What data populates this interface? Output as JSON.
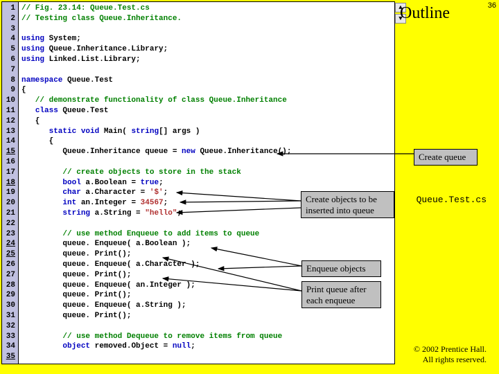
{
  "slide_number": "36",
  "outline": "Outline",
  "filename": "Queue.Test.cs",
  "copyright_line1": "© 2002 Prentice Hall.",
  "copyright_line2": "All rights reserved.",
  "scroll": {
    "up": "▲",
    "down": "▼"
  },
  "callouts": {
    "create_queue": "Create queue",
    "create_objects": "Create objects to be inserted into queue",
    "enqueue_objects": "Enqueue objects",
    "print_after": "Print queue after each enqueue"
  },
  "line_numbers": [
    "1",
    "2",
    "3",
    "4",
    "5",
    "6",
    "7",
    "8",
    "9",
    "10",
    "11",
    "12",
    "13",
    "14",
    "15",
    "16",
    "17",
    "18",
    "19",
    "20",
    "21",
    "22",
    "23",
    "24",
    "25",
    "26",
    "27",
    "28",
    "29",
    "30",
    "31",
    "32",
    "33",
    "34",
    "35"
  ],
  "underlined_lines": [
    "15",
    "18",
    "24",
    "25",
    "35"
  ],
  "code": {
    "l1": "// Fig. 23.14: Queue.Test.cs",
    "l2": "// Testing class Queue.Inheritance.",
    "l4a": "using",
    "l4b": " System;",
    "l5a": "using",
    "l5b": " Queue.Inheritance.Library;",
    "l6a": "using",
    "l6b": " Linked.List.Library;",
    "l8a": "namespace",
    "l8b": " Queue.Test",
    "l9": "{",
    "l10": "   // demonstrate functionality of class Queue.Inheritance",
    "l11a": "   ",
    "l11b": "class",
    "l11c": " Queue.Test",
    "l12": "   {",
    "l13a": "      ",
    "l13b": "static void",
    "l13c": " Main( ",
    "l13d": "string",
    "l13e": "[] args )",
    "l14": "      {",
    "l15a": "         Queue.Inheritance queue = ",
    "l15b": "new",
    "l15c": " Queue.Inheritance();",
    "l17": "         // create objects to store in the stack",
    "l18a": "         ",
    "l18b": "bool",
    "l18c": " a.Boolean = ",
    "l18d": "true",
    "l18e": ";",
    "l19a": "         ",
    "l19b": "char",
    "l19c": " a.Character = ",
    "l19d": "'$'",
    "l19e": ";",
    "l20a": "         ",
    "l20b": "int",
    "l20c": " an.Integer = ",
    "l20d": "34567",
    "l20e": ";",
    "l21a": "         ",
    "l21b": "string",
    "l21c": " a.String = ",
    "l21d": "\"hello\"",
    "l21e": ";",
    "l23": "         // use method Enqueue to add items to queue",
    "l24": "         queue. Enqueue( a.Boolean );",
    "l25": "         queue. Print();",
    "l26": "         queue. Enqueue( a.Character );",
    "l27": "         queue. Print();",
    "l28": "         queue. Enqueue( an.Integer );",
    "l29": "         queue. Print();",
    "l30": "         queue. Enqueue( a.String );",
    "l31": "         queue. Print();",
    "l33": "         // use method Dequeue to remove items from queue",
    "l34a": "         ",
    "l34b": "object",
    "l34c": " removed.Object = ",
    "l34d": "null",
    "l34e": ";"
  }
}
